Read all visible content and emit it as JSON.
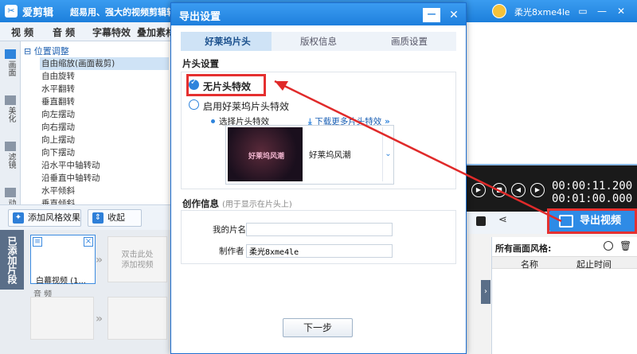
{
  "app": {
    "name": "爱剪辑",
    "slogan": "超易用、强大的视频剪辑软",
    "username": "柔光8xme4le"
  },
  "menu": {
    "items": [
      "视 频",
      "音 频",
      "字幕特效",
      "叠加素材"
    ]
  },
  "side_tabs": [
    "画面",
    "美化",
    "滤镜",
    "动景"
  ],
  "effects": {
    "group": "位置调整",
    "items": [
      "自由缩放(画面裁剪)",
      "自由旋转",
      "水平翻转",
      "垂直翻转",
      "向左摆动",
      "向右摆动",
      "向上摆动",
      "向下摆动",
      "沿水平中轴转动",
      "沿垂直中轴转动",
      "水平倾斜",
      "垂直倾斜"
    ]
  },
  "fx_buttons": {
    "add": "添加风格效果",
    "collapse": "收起"
  },
  "timeline": {
    "added_tab": "已添加片段",
    "clip_caption": "白幕视频 (1...",
    "add_slot": "双击此处\n添加视频",
    "audio_label": "音 频"
  },
  "player": {
    "time_current": "00:00:11.200",
    "time_total": "00:01:00.000",
    "export_label": "导出视频"
  },
  "style_panel": {
    "title": "所有画面风格:",
    "col_name": "名称",
    "col_time": "起止时间"
  },
  "dialog": {
    "title": "导出设置",
    "steps": [
      "好莱坞片头",
      "版权信息",
      "画质设置"
    ],
    "intro_section": "片头设置",
    "option_none": "无片头特效",
    "option_enable": "启用好莱坞片头特效",
    "select_label": "选择片头特效",
    "download_link": "下载更多片头特效",
    "preset_thumb_text": "好莱坞风潮",
    "preset_name": "好莱坞风潮",
    "info_section": "创作信息",
    "info_hint": "(用于显示在片头上)",
    "film_name_label": "我的片名",
    "film_name_value": "",
    "author_label": "制作者",
    "author_value": "柔光8xme4le",
    "next_button": "下一步"
  }
}
